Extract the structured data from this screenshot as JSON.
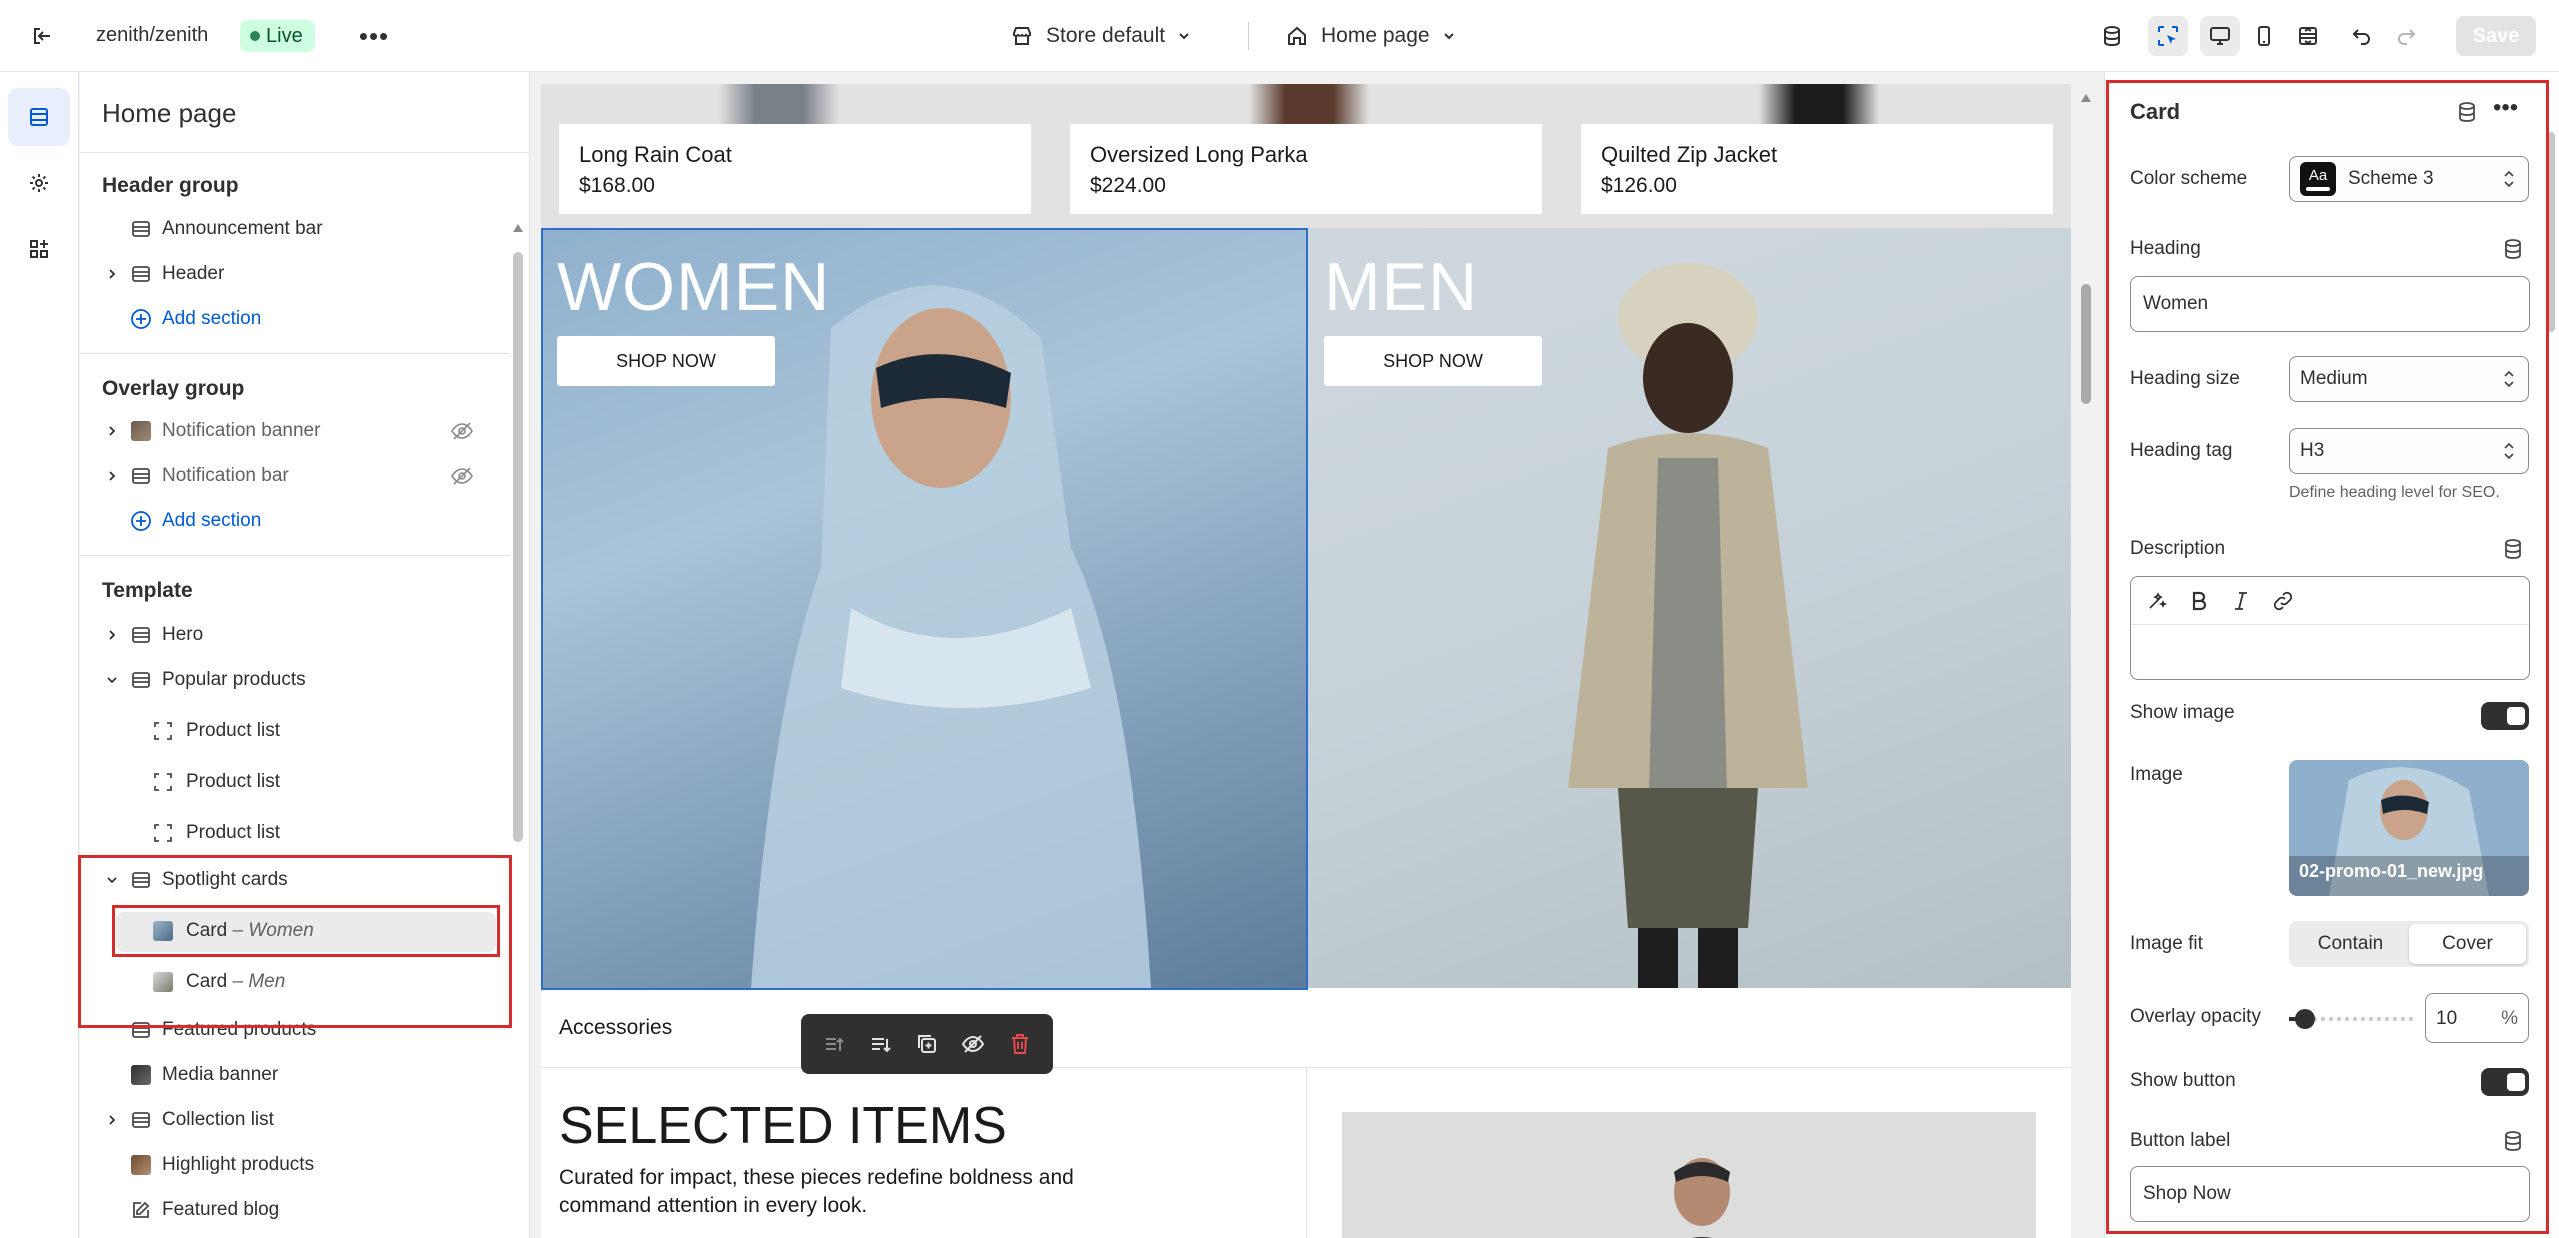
{
  "topbar": {
    "store_name": "zenith/zenith",
    "live_badge": "Live",
    "theme_selector": "Store default",
    "page_selector": "Home page",
    "save_label": "Save",
    "colors": {
      "live_bg": "#cdfee1",
      "live_text": "#0c5132",
      "accent": "#005bd3"
    }
  },
  "rail": {
    "items": [
      {
        "icon": "sections-icon",
        "active": true
      },
      {
        "icon": "gear-icon",
        "active": false
      },
      {
        "icon": "apps-icon",
        "active": false
      }
    ]
  },
  "sections_panel": {
    "title": "Home page",
    "header_group": {
      "title": "Header group",
      "items": [
        "Announcement bar",
        "Header"
      ],
      "add_label": "Add section"
    },
    "overlay_group": {
      "title": "Overlay group",
      "items": [
        "Notification banner",
        "Notification bar"
      ],
      "add_label": "Add section"
    },
    "template": {
      "title": "Template",
      "hero": "Hero",
      "popular_products": "Popular products",
      "product_list_1": "Product list",
      "product_list_2": "Product list",
      "product_list_3": "Product list",
      "spotlight_cards": "Spotlight cards",
      "card_women_name": "Card",
      "card_women_sub": "– Women",
      "card_men_name": "Card",
      "card_men_sub": "– Men",
      "featured_products": "Featured products",
      "media_banner": "Media banner",
      "collection_list": "Collection list",
      "highlight_products": "Highlight products",
      "featured_blog": "Featured blog"
    }
  },
  "preview": {
    "products": [
      {
        "name": "Long Rain Coat",
        "price": "$168.00"
      },
      {
        "name": "Oversized Long Parka",
        "price": "$224.00"
      },
      {
        "name": "Quilted Zip Jacket",
        "price": "$126.00"
      }
    ],
    "promo_women": {
      "title": "WOMEN",
      "button": "SHOP NOW"
    },
    "promo_men": {
      "title": "MEN",
      "button": "SHOP NOW"
    },
    "accessories_label": "Accessories",
    "selected_items_heading": "SELECTED ITEMS",
    "selected_items_desc": "Curated for impact, these pieces redefine boldness and command attention in every look."
  },
  "settings": {
    "title": "Card",
    "color_scheme_label": "Color scheme",
    "color_scheme_value": "Scheme 3",
    "color_scheme_swatch": "Aa",
    "heading_label": "Heading",
    "heading_value": "Women",
    "heading_size_label": "Heading size",
    "heading_size_value": "Medium",
    "heading_tag_label": "Heading tag",
    "heading_tag_value": "H3",
    "heading_tag_help": "Define heading level for SEO.",
    "description_label": "Description",
    "show_image_label": "Show image",
    "show_image_on": true,
    "image_label": "Image",
    "image_filename": "02-promo-01_new.jpg",
    "image_fit_label": "Image fit",
    "image_fit_options": [
      "Contain",
      "Cover"
    ],
    "image_fit_selected": "Cover",
    "overlay_opacity_label": "Overlay opacity",
    "overlay_opacity_value": "10",
    "overlay_opacity_unit": "%",
    "show_button_label": "Show button",
    "show_button_on": true,
    "button_label_label": "Button label",
    "button_label_value": "Shop Now"
  }
}
